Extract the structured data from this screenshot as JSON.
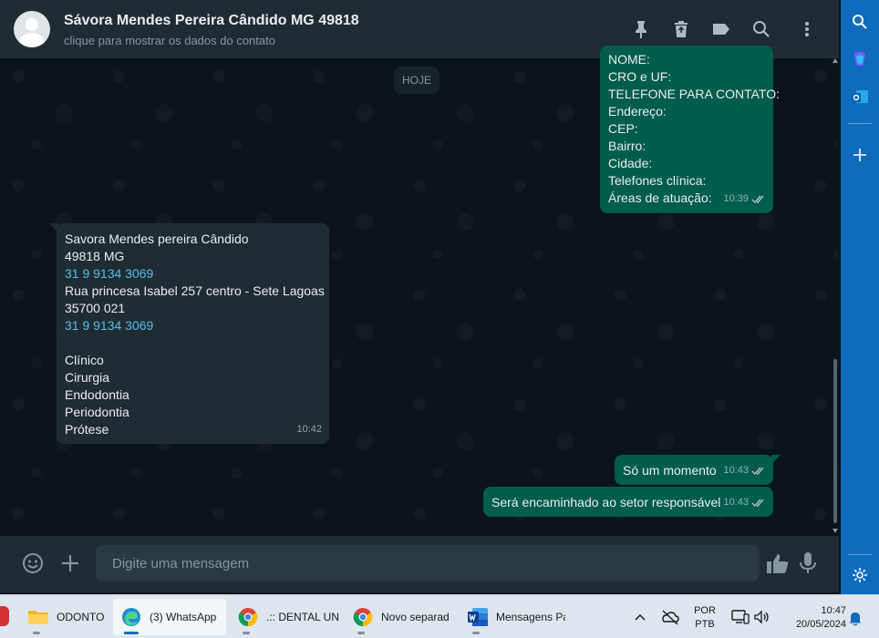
{
  "header": {
    "contact_name": "Sávora Mendes Pereira Cândido MG 49818",
    "contact_subtitle": "clique para mostrar os dados do contato"
  },
  "chat": {
    "date_label": "HOJE",
    "messages": [
      {
        "direction": "out",
        "lines": [
          "NOME:",
          "CRO e UF:",
          "TELEFONE PARA CONTATO:",
          "Endereço:",
          "CEP:",
          "Bairro:",
          "Cidade:",
          "Telefones clínica:",
          "Áreas de atuação:"
        ],
        "time": "10:39"
      },
      {
        "direction": "in",
        "lines": [
          "Savora Mendes pereira Cândido",
          "49818 MG",
          "31 9 9134 3069",
          "Rua princesa Isabel 257 centro - Sete Lagoas",
          "35700 021",
          "31 9 9134 3069",
          "",
          "Clínico",
          "Cirurgia",
          "Endodontia",
          "Periodontia",
          "Prótese"
        ],
        "time": "10:42"
      },
      {
        "direction": "out",
        "lines": [
          "Só um momento"
        ],
        "time": "10:43"
      },
      {
        "direction": "out",
        "lines": [
          "Será encaminhado ao setor responsável"
        ],
        "time": "10:43"
      }
    ]
  },
  "composer": {
    "placeholder": "Digite uma mensagem"
  },
  "taskbar": {
    "items": [
      {
        "label": "ODONTO",
        "icon": "folder-icon"
      },
      {
        "label": "(3) WhatsApp",
        "icon": "edge-icon",
        "active": true
      },
      {
        "label": ".:: DENTAL UN",
        "icon": "chrome-icon"
      },
      {
        "label": "Novo separad",
        "icon": "chrome-icon"
      },
      {
        "label": "Mensagens Pa",
        "icon": "word-icon"
      }
    ],
    "language": "POR",
    "layout": "PTB",
    "time": "10:47",
    "date": "20/05/2024"
  },
  "colors": {
    "outgoing_bubble": "#005c4b",
    "incoming_bubble": "#202c33",
    "link": "#53bdeb",
    "edge_sidebar": "#0f6cbd"
  }
}
